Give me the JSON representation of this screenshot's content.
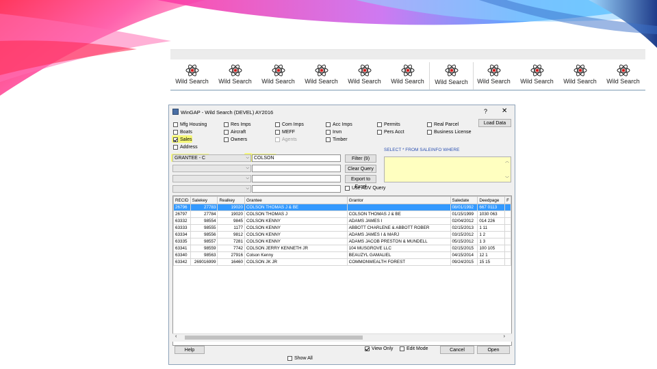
{
  "toolbar": {
    "items": [
      {
        "label": "Wild Search",
        "selected": false
      },
      {
        "label": "Wild Search",
        "selected": false
      },
      {
        "label": "Wild Search",
        "selected": false
      },
      {
        "label": "Wild Search",
        "selected": false
      },
      {
        "label": "Wild Search",
        "selected": false
      },
      {
        "label": "Wild Search",
        "selected": false
      },
      {
        "label": "Wild Search",
        "selected": true
      },
      {
        "label": "Wild Search",
        "selected": false
      },
      {
        "label": "Wild Search",
        "selected": false
      },
      {
        "label": "Wild Search",
        "selected": false
      },
      {
        "label": "Wild Search",
        "selected": false
      }
    ]
  },
  "dialog": {
    "title": "WinGAP - Wild Search (DEVEL) AY2016",
    "help_glyph": "?",
    "close_glyph": "✕",
    "checkboxes": [
      {
        "key": "mfg_housing",
        "label": "Mfg Housing",
        "checked": false,
        "enabled": true
      },
      {
        "key": "boats",
        "label": "Boats",
        "checked": false,
        "enabled": true
      },
      {
        "key": "sales",
        "label": "Sales",
        "checked": true,
        "enabled": true
      },
      {
        "key": "address",
        "label": "Address",
        "checked": false,
        "enabled": true
      },
      {
        "key": "res_imps",
        "label": "Res Imps",
        "checked": false,
        "enabled": true
      },
      {
        "key": "aircraft",
        "label": "Aircraft",
        "checked": false,
        "enabled": true
      },
      {
        "key": "owners",
        "label": "Owners",
        "checked": false,
        "enabled": true
      },
      {
        "key": "com_imps",
        "label": "Com Imps",
        "checked": false,
        "enabled": true
      },
      {
        "key": "meff",
        "label": "MEFF",
        "checked": false,
        "enabled": true
      },
      {
        "key": "agents",
        "label": "Agents",
        "checked": false,
        "enabled": false
      },
      {
        "key": "acc_imps",
        "label": "Acc Imps",
        "checked": false,
        "enabled": true
      },
      {
        "key": "invn",
        "label": "Invn",
        "checked": false,
        "enabled": true
      },
      {
        "key": "timber",
        "label": "Timber",
        "checked": false,
        "enabled": true
      },
      {
        "key": "permits",
        "label": "Permits",
        "checked": false,
        "enabled": true
      },
      {
        "key": "pers_acct",
        "label": "Pers Acct",
        "checked": false,
        "enabled": true
      },
      {
        "key": "real_parcel",
        "label": "Real Parcel",
        "checked": false,
        "enabled": true
      },
      {
        "key": "business_license",
        "label": "Business License",
        "checked": false,
        "enabled": true
      }
    ],
    "load_data_label": "Load Data",
    "sql_label": "SELECT * FROM SALEINFO WHERE",
    "filters": [
      {
        "field": "GRANTEE - C",
        "value": "COLSON"
      },
      {
        "field": "",
        "value": ""
      },
      {
        "field": "",
        "value": ""
      },
      {
        "field": "",
        "value": ""
      }
    ],
    "filter_button": "Filter (9)",
    "clear_query_button": "Clear Query",
    "export_button": "Export to Excel",
    "use_adv_query": {
      "label": "Use ADV Query",
      "checked": false
    },
    "grid": {
      "columns": [
        "RECID",
        "Salekey",
        "Realkey",
        "Grantee",
        "Grantor",
        "Saledate",
        "Deedpage",
        "F"
      ],
      "rows": [
        [
          "26796",
          "27783",
          "19020",
          "COLSON THOMAS J & BE",
          "",
          "08/01/1992",
          "667 0113",
          ""
        ],
        [
          "26797",
          "27784",
          "19020",
          "COLSON THOMAS J",
          "COLSON THOMAS J & BE",
          "01/15/1999",
          "1030 063",
          ""
        ],
        [
          "63332",
          "98554",
          "9845",
          "COLSON KENNY",
          "ADAMS JAMES I",
          "02/04/2012",
          "014  226",
          ""
        ],
        [
          "63333",
          "98555",
          "1177",
          "COLSON KENNY",
          "ABBOTT CHARLENE & ABBOTT ROBER",
          "02/15/2013",
          "1   11",
          ""
        ],
        [
          "63334",
          "98556",
          "9812",
          "COLSON KENNY",
          "ADAMS JAMES I & MARJ",
          "03/15/2012",
          "1   2",
          ""
        ],
        [
          "63335",
          "98557",
          "7281",
          "COLSON KENNY",
          "ADAMS JACOB PRESTON & MUNDELL",
          "05/15/2012",
          "1   3",
          ""
        ],
        [
          "63341",
          "98559",
          "7742",
          "COLSON JERRY KENNETH JR",
          "104 MUSGROVE LLC",
          "02/15/2015",
          "100  105",
          ""
        ],
        [
          "63340",
          "98563",
          "27916",
          "Colson Kenny",
          "BEAUZYL GAMALIEL",
          "04/15/2014",
          "12   1",
          ""
        ],
        [
          "63342",
          "269016999",
          "16460",
          "COLSON JK JR",
          "COMMONWEALTH FOREST",
          "09/24/2015",
          "15   15",
          ""
        ]
      ],
      "selected_row": 0
    },
    "help_button": "Help",
    "view_only": {
      "label": "View Only",
      "checked": true
    },
    "edit_mode": {
      "label": "Edit Mode",
      "checked": false
    },
    "cancel_button": "Cancel",
    "open_button": "Open",
    "show_all": {
      "label": "Show All",
      "checked": false
    }
  },
  "colors": {
    "highlight": "#f5f76a",
    "selected_row": "#3399ff",
    "sql_area": "#ffffc0",
    "sql_label": "#2a4fb0"
  }
}
